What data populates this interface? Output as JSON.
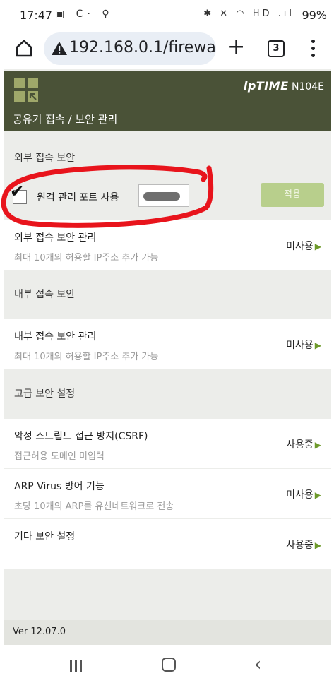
{
  "status_bar": {
    "time": "17:47",
    "left_icons": "▣ C· ⚲",
    "right_icons": "✱ ✕ ◠ HD .ıl",
    "battery": "99%"
  },
  "browser": {
    "url": "192.168.0.1/firewa",
    "tab_count": "3",
    "icons": [
      "home-icon",
      "warning-icon",
      "plus-icon",
      "tabs-icon",
      "overflow-menu-icon"
    ]
  },
  "router": {
    "brand": "ipTIME",
    "model": "N104E",
    "page_title": "공유기 접속 / 보안 관리",
    "external_section": "외부 접속 보안",
    "remote_mgmt_label": "원격 관리 포트 사용",
    "remote_mgmt_checked": true,
    "apply_label": "적용",
    "internal_section": "내부 접속 보안",
    "advanced_section": "고급 보안 설정",
    "items": [
      {
        "title": "외부 접속 보안 관리",
        "desc": "최대 10개의 허용할 IP주소 추가 가능",
        "status": "미사용"
      },
      {
        "title": "내부 접속 보안 관리",
        "desc": "최대 10개의 허용할 IP주소 추가 가능",
        "status": "미사용"
      },
      {
        "title": "악성 스트립트 접근 방지(CSRF)",
        "desc": "접근허용 도메인 미입력",
        "status": "사용중"
      },
      {
        "title": "ARP Virus 방어 기능",
        "desc": "초당 10개의 ARP를 유선네트워크로 전송",
        "status": "미사용"
      },
      {
        "title": "기타 보안 설정",
        "desc": "",
        "status": "사용중"
      }
    ],
    "arrow": "▶",
    "version": "Ver 12.07.0"
  },
  "colors": {
    "header_bg": "#4a5237",
    "logo": "#9fa86a",
    "apply_button": "#b8cf8c",
    "annotation": "#e8141c",
    "arrow": "#6e9a2b"
  }
}
